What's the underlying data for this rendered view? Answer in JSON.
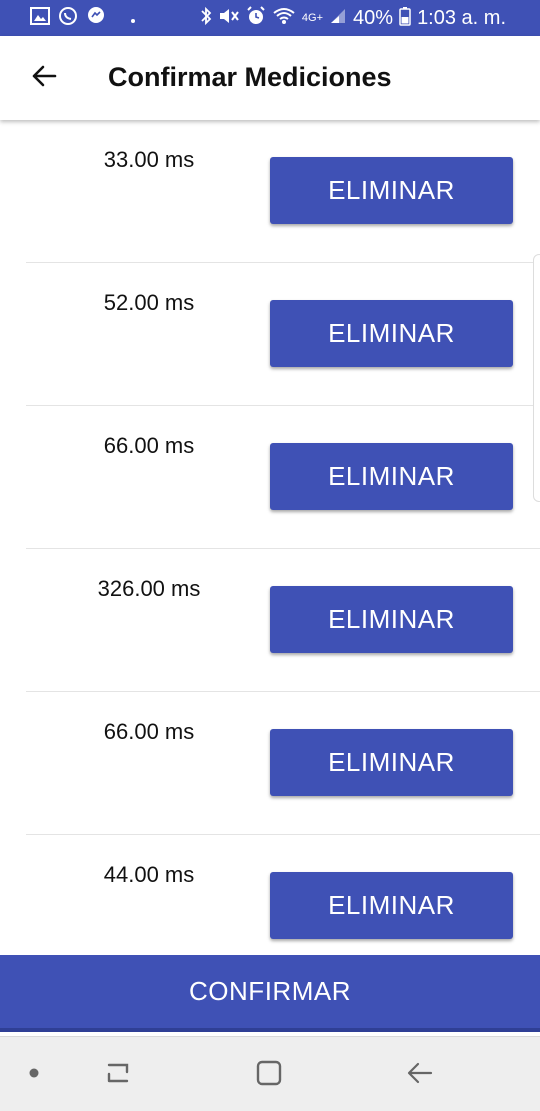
{
  "status_bar": {
    "battery_text": "40%",
    "time": "1:03 a. m.",
    "network_label": "4G+",
    "left_icons": [
      "gallery-icon",
      "whatsapp-icon",
      "messenger-icon",
      "dot-icon"
    ],
    "right_icons": [
      "bluetooth-icon",
      "mute-icon",
      "alarm-icon",
      "wifi-icon",
      "signal-icon",
      "battery-icon"
    ]
  },
  "app_bar": {
    "title": "Confirmar Mediciones",
    "back_icon": "arrow-left-icon"
  },
  "measurements": [
    {
      "value": "33.00 ms",
      "button_label": "ELIMINAR"
    },
    {
      "value": "52.00 ms",
      "button_label": "ELIMINAR"
    },
    {
      "value": "66.00 ms",
      "button_label": "ELIMINAR"
    },
    {
      "value": "326.00 ms",
      "button_label": "ELIMINAR"
    },
    {
      "value": "66.00 ms",
      "button_label": "ELIMINAR"
    },
    {
      "value": "44.00 ms",
      "button_label": "ELIMINAR"
    }
  ],
  "confirm_button": {
    "label": "CONFIRMAR"
  },
  "colors": {
    "primary": "#3f51b5",
    "navbar_bg": "#eeeeee",
    "text": "#111111"
  },
  "nav_bar": {
    "items": [
      "dot-icon",
      "recents-icon",
      "home-icon",
      "back-icon"
    ]
  }
}
